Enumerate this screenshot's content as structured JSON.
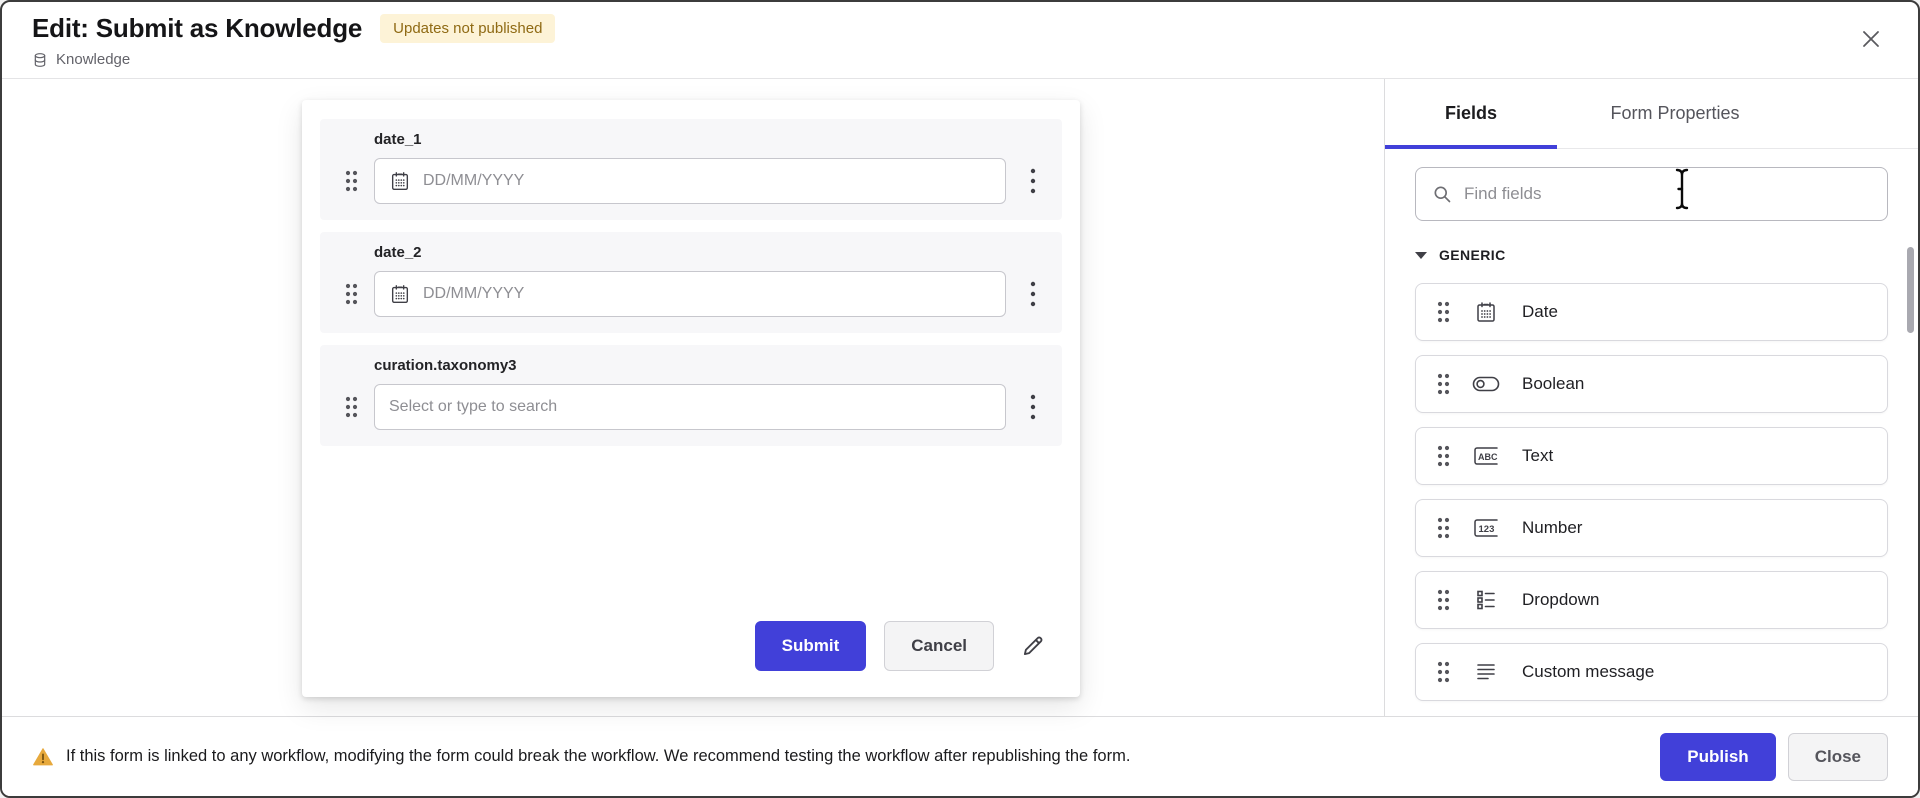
{
  "header": {
    "title": "Edit: Submit as Knowledge",
    "status_badge": "Updates not published",
    "source_label": "Knowledge"
  },
  "form_preview": {
    "fields": [
      {
        "label": "date_1",
        "placeholder": "DD/MM/YYYY",
        "type": "date"
      },
      {
        "label": "date_2",
        "placeholder": "DD/MM/YYYY",
        "type": "date"
      },
      {
        "label": "curation.taxonomy3",
        "placeholder": "Select or type to search",
        "type": "select"
      }
    ],
    "submit_label": "Submit",
    "cancel_label": "Cancel"
  },
  "sidebar": {
    "tabs": [
      {
        "label": "Fields",
        "active": true
      },
      {
        "label": "Form Properties",
        "active": false
      }
    ],
    "search_placeholder": "Find fields",
    "section_label": "GENERIC",
    "items": [
      {
        "label": "Date",
        "icon": "calendar-icon"
      },
      {
        "label": "Boolean",
        "icon": "toggle-icon"
      },
      {
        "label": "Text",
        "icon": "abc-icon"
      },
      {
        "label": "Number",
        "icon": "number-123-icon"
      },
      {
        "label": "Dropdown",
        "icon": "list-icon"
      },
      {
        "label": "Custom message",
        "icon": "text-lines-icon"
      }
    ]
  },
  "footer": {
    "warning_text": "If this form is linked to any workflow, modifying the form could break the workflow. We recommend testing the workflow after republishing the form.",
    "publish_label": "Publish",
    "close_label": "Close"
  },
  "colors": {
    "primary": "#4140d9",
    "badge_bg": "#fdf3d7",
    "badge_text": "#8f6a14",
    "warning_icon": "#e7a93c",
    "field_row_bg": "#f7f7f9"
  }
}
